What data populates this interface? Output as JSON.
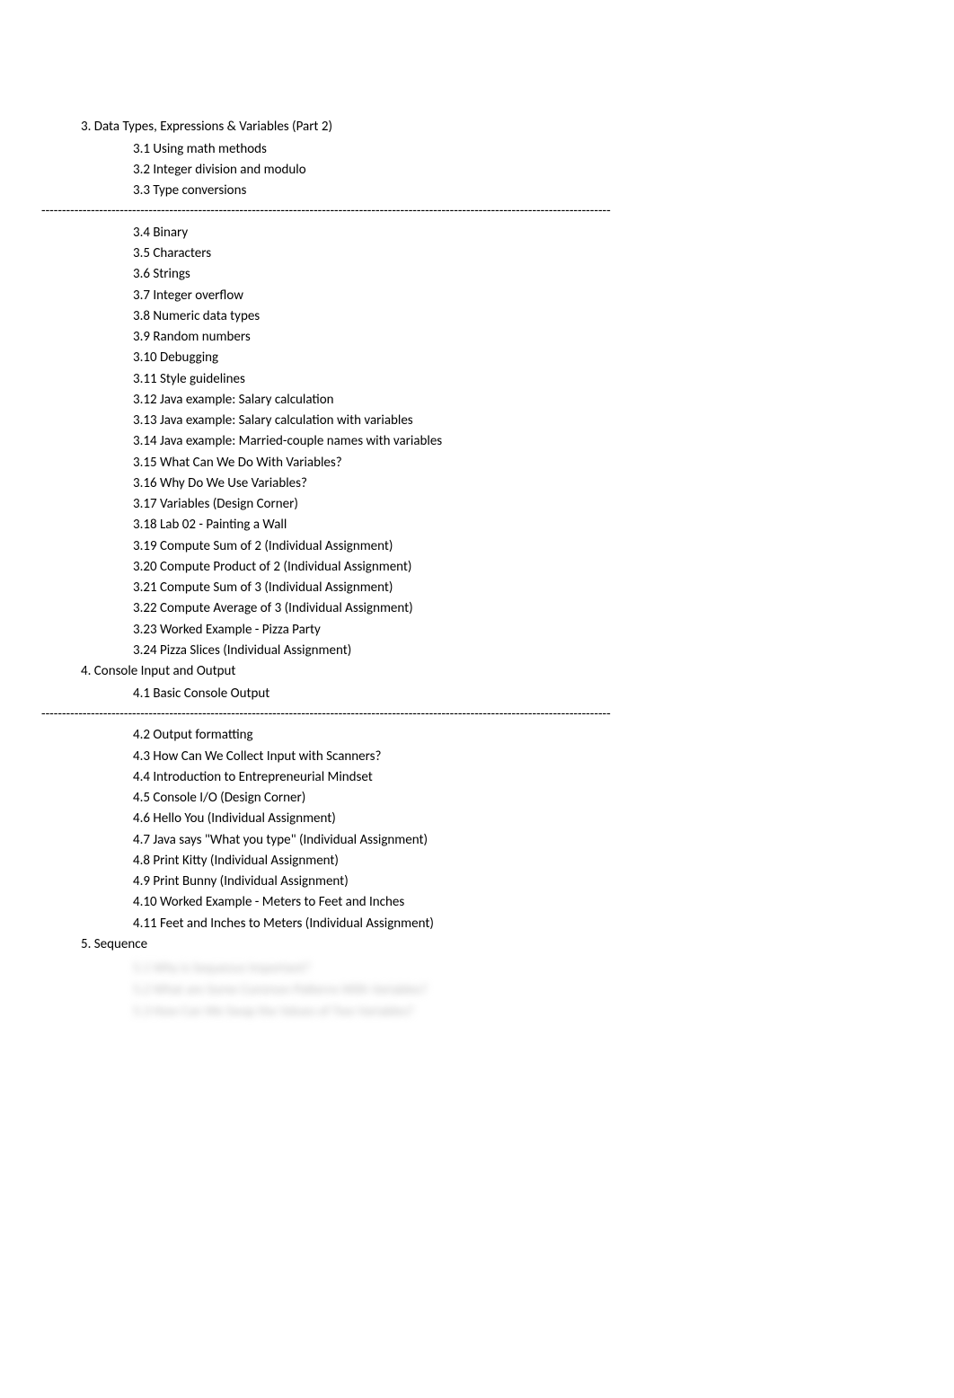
{
  "sections": [
    {
      "title": "3. Data Types, Expressions & Variables (Part 2)",
      "groups": [
        {
          "items": [
            "3.1 Using math methods",
            "3.2 Integer division and modulo",
            "3.3 Type conversions"
          ]
        },
        {
          "divider": true
        },
        {
          "items": [
            "3.4 Binary",
            "3.5 Characters",
            "3.6 Strings",
            "3.7 Integer overflow",
            "3.8 Numeric data types",
            "3.9 Random numbers",
            "3.10 Debugging",
            "3.11 Style guidelines",
            "3.12 Java example: Salary calculation",
            "3.13 Java example: Salary calculation with variables",
            "3.14 Java example: Married-couple names with variables",
            "3.15 What Can We Do With Variables?",
            "3.16 Why Do We Use Variables?",
            "3.17 Variables (Design Corner)",
            "3.18 Lab 02 - Painting a Wall",
            "3.19 Compute Sum of 2 (Individual Assignment)",
            "3.20 Compute Product of 2 (Individual Assignment)",
            "3.21 Compute Sum of 3 (Individual Assignment)",
            "3.22 Compute Average of 3 (Individual Assignment)",
            "3.23 Worked Example - Pizza Party",
            "3.24 Pizza Slices (Individual Assignment)"
          ]
        }
      ]
    },
    {
      "title": "4. Console Input and Output",
      "groups": [
        {
          "items": [
            "4.1 Basic Console Output"
          ]
        },
        {
          "divider": true
        },
        {
          "items": [
            "4.2 Output formatting",
            "4.3 How Can We Collect Input with Scanners?",
            "4.4 Introduction to Entrepreneurial Mindset",
            "4.5 Console I/O (Design Corner)",
            "4.6 Hello You (Individual Assignment)",
            "4.7 Java says \"What you type\" (Individual Assignment)",
            "4.8 Print Kitty (Individual Assignment)",
            "4.9 Print Bunny (Individual Assignment)",
            "4.10 Worked Example - Meters to Feet and Inches",
            "4.11 Feet and Inches to Meters (Individual Assignment)"
          ]
        }
      ]
    },
    {
      "title": "5. Sequence",
      "groups": [
        {
          "blurred": [
            "5.1 Why is Sequence Important?",
            "5.2 What are Some Common Patterns With Variables?",
            "5.3 How Can We Swap the Values of Two Variables?"
          ]
        }
      ]
    }
  ],
  "divider_char": "-"
}
